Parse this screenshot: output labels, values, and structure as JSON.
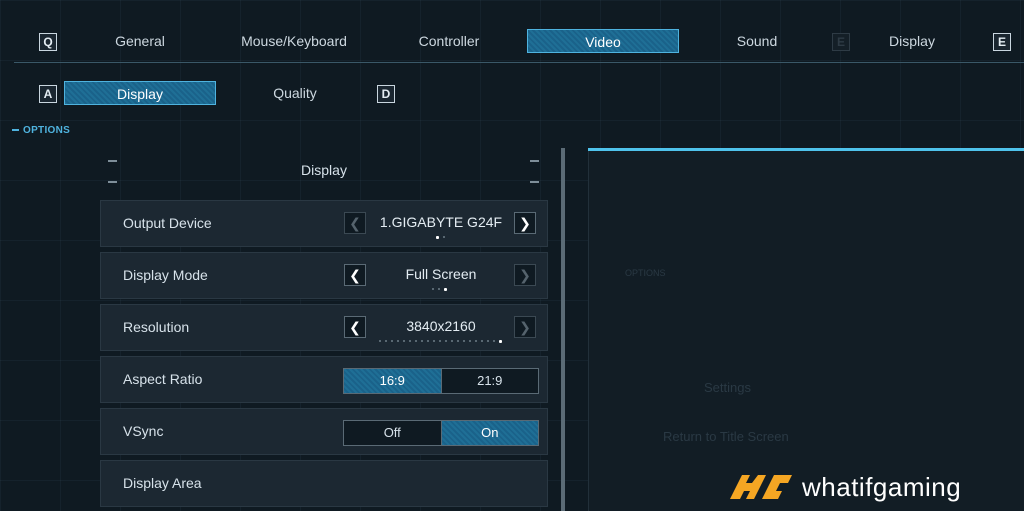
{
  "top_tabs": {
    "left_key": "Q",
    "right_key": "E",
    "dim_key": "E",
    "items": [
      {
        "label": "General"
      },
      {
        "label": "Mouse/Keyboard"
      },
      {
        "label": "Controller"
      },
      {
        "label": "Video",
        "active": true
      },
      {
        "label": "Sound"
      },
      {
        "label": "Display"
      }
    ]
  },
  "sub_tabs": {
    "left_key": "A",
    "right_key": "D",
    "items": [
      {
        "label": "Display",
        "active": true
      },
      {
        "label": "Quality"
      }
    ]
  },
  "options_label": "OPTIONS",
  "section": {
    "title": "Display"
  },
  "settings": {
    "output_device": {
      "label": "Output Device",
      "value": "1.GIGABYTE G24F",
      "option_count": 2,
      "option_index": 0
    },
    "display_mode": {
      "label": "Display Mode",
      "value": "Full Screen",
      "option_count": 3,
      "option_index": 2
    },
    "resolution": {
      "label": "Resolution",
      "value": "3840x2160",
      "option_count": 21,
      "option_index": 20
    },
    "aspect_ratio": {
      "label": "Aspect Ratio",
      "options": [
        "16:9",
        "21:9"
      ],
      "selected": "16:9"
    },
    "vsync": {
      "label": "VSync",
      "options": [
        "Off",
        "On"
      ],
      "selected": "On"
    },
    "display_area": {
      "label": "Display Area"
    }
  },
  "preview": {
    "ghost_options": "OPTIONS",
    "ghost_settings": "Settings",
    "ghost_return": "Return to Title Screen"
  },
  "watermark": {
    "text": "whatifgaming"
  },
  "colors": {
    "accent": "#4fb3df",
    "active_fill": "#1f6f96",
    "background": "#0f1a22",
    "watermark_logo": "#f5a623"
  }
}
